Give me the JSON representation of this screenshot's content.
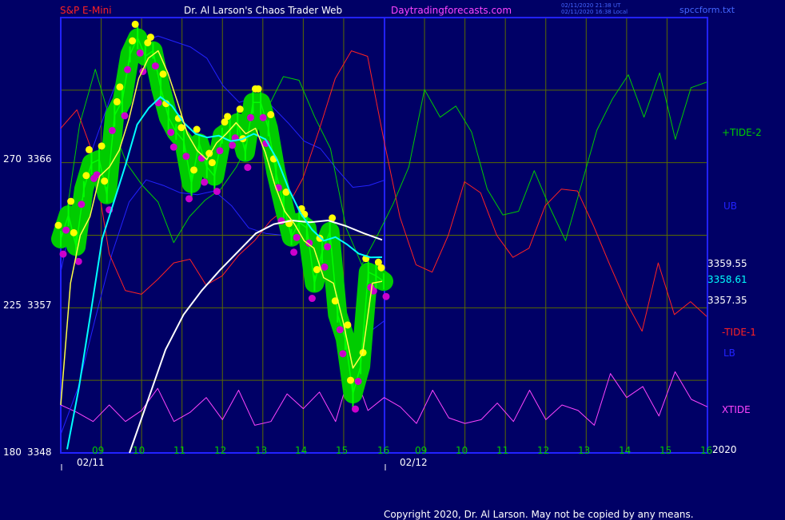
{
  "header": {
    "symbol": "S&P E-Mini",
    "title": "Dr. Al Larson's Chaos Trader Web",
    "site": "Daytradingforecasts.com",
    "time_utc": "02/11/2020 21:38 UT",
    "time_local": "02/11/2020 16:38 Local",
    "file": "spccform.txt"
  },
  "copyright": "Copyright 2020, Dr. Al Larson. May not be copied by any means.",
  "chart_data": {
    "type": "line",
    "title": "S&P E-Mini",
    "y_axis": {
      "labels": [
        {
          "angle": "270",
          "price": "3366",
          "value": 3366
        },
        {
          "angle": "225",
          "price": "3357",
          "value": 3357
        },
        {
          "angle": "180",
          "price": "3348",
          "value": 3348
        }
      ],
      "range": [
        3348,
        3371.6
      ]
    },
    "x_axis": {
      "hours": [
        "09",
        "10",
        "11",
        "12",
        "13",
        "14",
        "15",
        "16",
        "09",
        "10",
        "11",
        "12",
        "13",
        "14",
        "15",
        "16"
      ],
      "dates": [
        "02/11",
        "02/12"
      ],
      "corner_label": "2020"
    },
    "price_labels": [
      {
        "text": "3359.55",
        "value": 3359.55,
        "color": "#ffffff"
      },
      {
        "text": "3358.61",
        "value": 3358.61,
        "color": "#00ffff"
      },
      {
        "text": "3357.35",
        "value": 3357.35,
        "color": "#ffffff"
      }
    ],
    "legend": [
      {
        "name": "+TIDE-2",
        "color": "#00cc00"
      },
      {
        "name": "UB",
        "color": "#2222ff"
      },
      {
        "name": "-TIDE-1",
        "color": "#ff2222"
      },
      {
        "name": "LB",
        "color": "#2222ff"
      },
      {
        "name": "XTIDE",
        "color": "#ff44ff"
      }
    ],
    "colors": {
      "background": "#000066",
      "grid": "#5a6a00",
      "frame": "#2222ff",
      "price_ribbon": "#00cc00",
      "price_bars": "#00ff00",
      "highs": "#ffff00",
      "lows": "#cc00cc",
      "fast_average": "#ffff44",
      "mid_average": "#00ffff",
      "slow_average": "#ffffff",
      "tide_pos": "#00cc00",
      "tide_neg": "#ff2222",
      "bands": "#2222ff",
      "xtide": "#ff44ff"
    },
    "series": [
      {
        "key": "price",
        "values": [
          3359.6,
          3360.9,
          3359.2,
          3362.3,
          3363.7,
          3363.9,
          3362.0,
          3366.3,
          3367.1,
          3369.6,
          3370.5,
          3369.5,
          3369.8,
          3367.8,
          3366.2,
          3365.4,
          3364.9,
          3362.6,
          3364.8,
          3363.5,
          3363.0,
          3365.2,
          3365.5,
          3365.9,
          3364.3,
          3367.0,
          3367.0,
          3365.6,
          3363.2,
          3361.4,
          3359.7,
          3360.5,
          3360.2,
          3357.2,
          3358.9,
          3360.0,
          3355.5,
          3354.2,
          3351.2,
          3352.7,
          3357.8,
          3357.6,
          3357.3
        ]
      },
      {
        "key": "fast_average",
        "values": [
          3350.6,
          3357.2,
          3359.8,
          3360.8,
          3363.0,
          3363.5,
          3364.4,
          3366.1,
          3368.3,
          3369.4,
          3369.8,
          3368.6,
          3367.0,
          3365.3,
          3364.4,
          3363.9,
          3364.8,
          3365.3,
          3365.9,
          3365.3,
          3365.6,
          3364.3,
          3362.5,
          3361.1,
          3360.4,
          3359.5,
          3359.1,
          3357.5,
          3357.2,
          3355.1,
          3352.6,
          3353.4,
          3357.2,
          3357.3
        ]
      },
      {
        "key": "mid_average",
        "values": [
          3348.2,
          3351.5,
          3355.5,
          3359.6,
          3361.6,
          3363.6,
          3365.8,
          3366.7,
          3367.3,
          3366.8,
          3365.9,
          3365.3,
          3365.1,
          3365.2,
          3364.9,
          3365.0,
          3365.3,
          3365.0,
          3363.9,
          3362.3,
          3361.0,
          3360.1,
          3359.5,
          3359.7,
          3359.3,
          3358.8,
          3358.6,
          3358.61
        ]
      },
      {
        "key": "slow_average",
        "values": [
          3348.0,
          3350.8,
          3353.6,
          3355.5,
          3356.8,
          3357.9,
          3358.9,
          3359.9,
          3360.4,
          3360.6,
          3360.5,
          3360.6,
          3360.3,
          3359.9,
          3359.55
        ]
      },
      {
        "key": "tide_pos",
        "values": [
          3360.0,
          3365.8,
          3368.8,
          3365.9,
          3363.7,
          3362.5,
          3361.6,
          3359.4,
          3360.8,
          3361.7,
          3362.3,
          3363.5,
          3365.2,
          3366.7,
          3368.4,
          3368.2,
          3366.2,
          3364.5,
          3360.2,
          3358.2,
          3359.8,
          3361.5,
          3363.5,
          3367.7,
          3366.2,
          3366.8,
          3365.4,
          3362.3,
          3360.9,
          3361.1,
          3363.3,
          3361.3,
          3359.5,
          3362.5,
          3365.5,
          3367.2,
          3368.5,
          3366.2,
          3368.6,
          3365.0,
          3367.8,
          3368.1
        ]
      },
      {
        "key": "tide_neg",
        "values": [
          3365.6,
          3366.6,
          3364.2,
          3358.8,
          3356.8,
          3356.6,
          3357.4,
          3358.3,
          3358.5,
          3357.1,
          3357.6,
          3358.7,
          3359.5,
          3360.6,
          3361.3,
          3362.9,
          3365.5,
          3368.3,
          3369.8,
          3369.5,
          3365.0,
          3360.8,
          3358.2,
          3357.8,
          3359.8,
          3362.7,
          3362.1,
          3359.8,
          3358.6,
          3359.1,
          3361.4,
          3362.3,
          3362.2,
          3360.3,
          3358.2,
          3356.2,
          3354.6,
          3358.3,
          3355.5,
          3356.2,
          3355.4
        ]
      },
      {
        "key": "upper_band",
        "values": [
          3357.8,
          3362.1,
          3364.6,
          3367.1,
          3369.4,
          3370.3,
          3370.6,
          3370.3,
          3370.0,
          3369.4,
          3367.9,
          3367.0,
          3367.3,
          3366.8,
          3365.9,
          3364.9,
          3364.5,
          3363.4,
          3362.4,
          3362.5,
          3362.8
        ]
      },
      {
        "key": "lower_band",
        "values": [
          3349.0,
          3351.5,
          3355.2,
          3358.8,
          3361.6,
          3362.8,
          3362.5,
          3362.1,
          3362.0,
          3362.2,
          3361.4,
          3360.2,
          3359.9,
          3359.8,
          3359.6,
          3358.3,
          3356.3,
          3354.3,
          3354.5,
          3355.2
        ]
      },
      {
        "key": "xtide",
        "values": [
          3350.6,
          3350.2,
          3349.7,
          3350.6,
          3349.7,
          3350.3,
          3351.5,
          3349.7,
          3350.2,
          3351.0,
          3349.8,
          3351.4,
          3349.5,
          3349.7,
          3351.2,
          3350.4,
          3351.3,
          3349.7,
          3352.7,
          3350.3,
          3351.0,
          3350.5,
          3349.6,
          3351.4,
          3349.9,
          3349.6,
          3349.8,
          3350.7,
          3349.7,
          3351.4,
          3349.8,
          3350.6,
          3350.3,
          3349.5,
          3352.3,
          3351.0,
          3351.6,
          3350.0,
          3352.4,
          3350.9,
          3350.5
        ]
      }
    ]
  }
}
